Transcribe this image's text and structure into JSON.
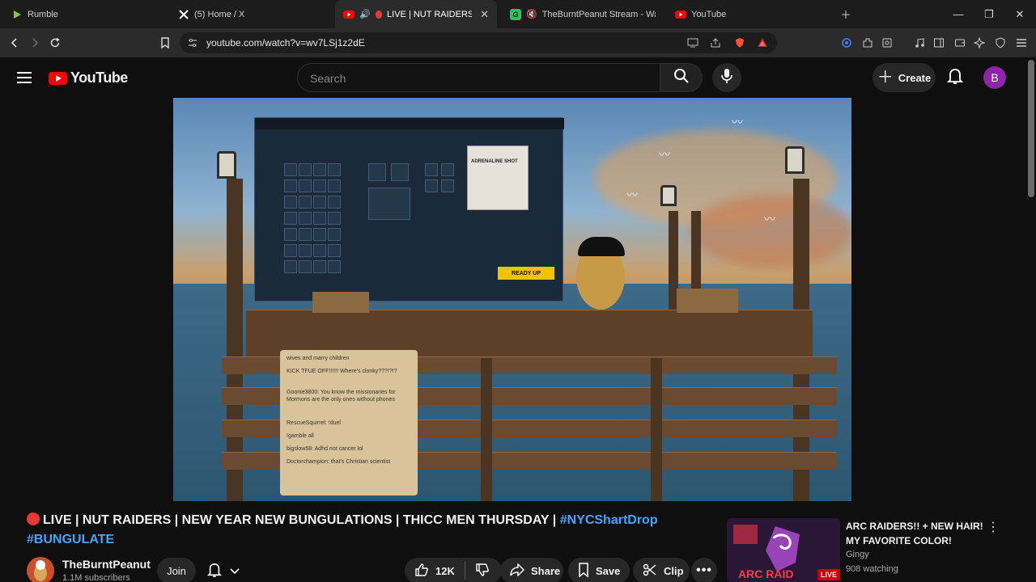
{
  "browser": {
    "tabs": [
      {
        "label": "Rumble",
        "favicon": "rumble-icon",
        "color": "#85c742"
      },
      {
        "label": "(5) Home / X",
        "favicon": "x-icon",
        "color": "#ffffff"
      },
      {
        "label": "LIVE | NUT RAIDERS | NEW",
        "favicon": "youtube-icon",
        "color": "#ff0000"
      },
      {
        "label": "TheBurntPeanut Stream - Watch",
        "favicon": "gamesight-icon",
        "color": "#22c55e"
      },
      {
        "label": "YouTube",
        "favicon": "youtube-icon",
        "color": "#ff0000"
      }
    ],
    "url": "youtube.com/watch?v=wv7LSj1z2dE"
  },
  "header": {
    "logo_text": "YouTube",
    "search_placeholder": "Search",
    "create_label": "Create",
    "avatar_letter": "B"
  },
  "video": {
    "game_ready_label": "READY UP",
    "tooltip_title": "ADRENALINE SHOT",
    "chat": [
      "wives and marry children",
      "KICK TFUE OFF!!!!!! Where's clonky???!?!?",
      "Goonie3800: You know the missionaries for Mormons are the only ones without phones",
      "RescueSquirrel: !duel",
      "!gamble all",
      "bigslow58: Adhd not cancer lol",
      "Doctorchampion: that's Christian scientist"
    ]
  },
  "title": {
    "text": "LIVE | NUT RAIDERS | NEW YEAR NEW BUNGULATIONS | THICC MEN THURSDAY | ",
    "hashtag1": "#NYCShartDrop",
    "hashtag2": "#BUNGULATE"
  },
  "channel": {
    "name": "TheBurntPeanut",
    "subscribers": "1.1M subscribers",
    "join_label": "Join"
  },
  "actions": {
    "likes": "12K",
    "share": "Share",
    "save": "Save",
    "clip": "Clip"
  },
  "recommendation": {
    "title": "ARC RAIDERS!! + NEW HAIR! MY FAVORITE COLOR!",
    "channel": "Gingy",
    "watching": "908 watching",
    "badge": "LIVE"
  }
}
